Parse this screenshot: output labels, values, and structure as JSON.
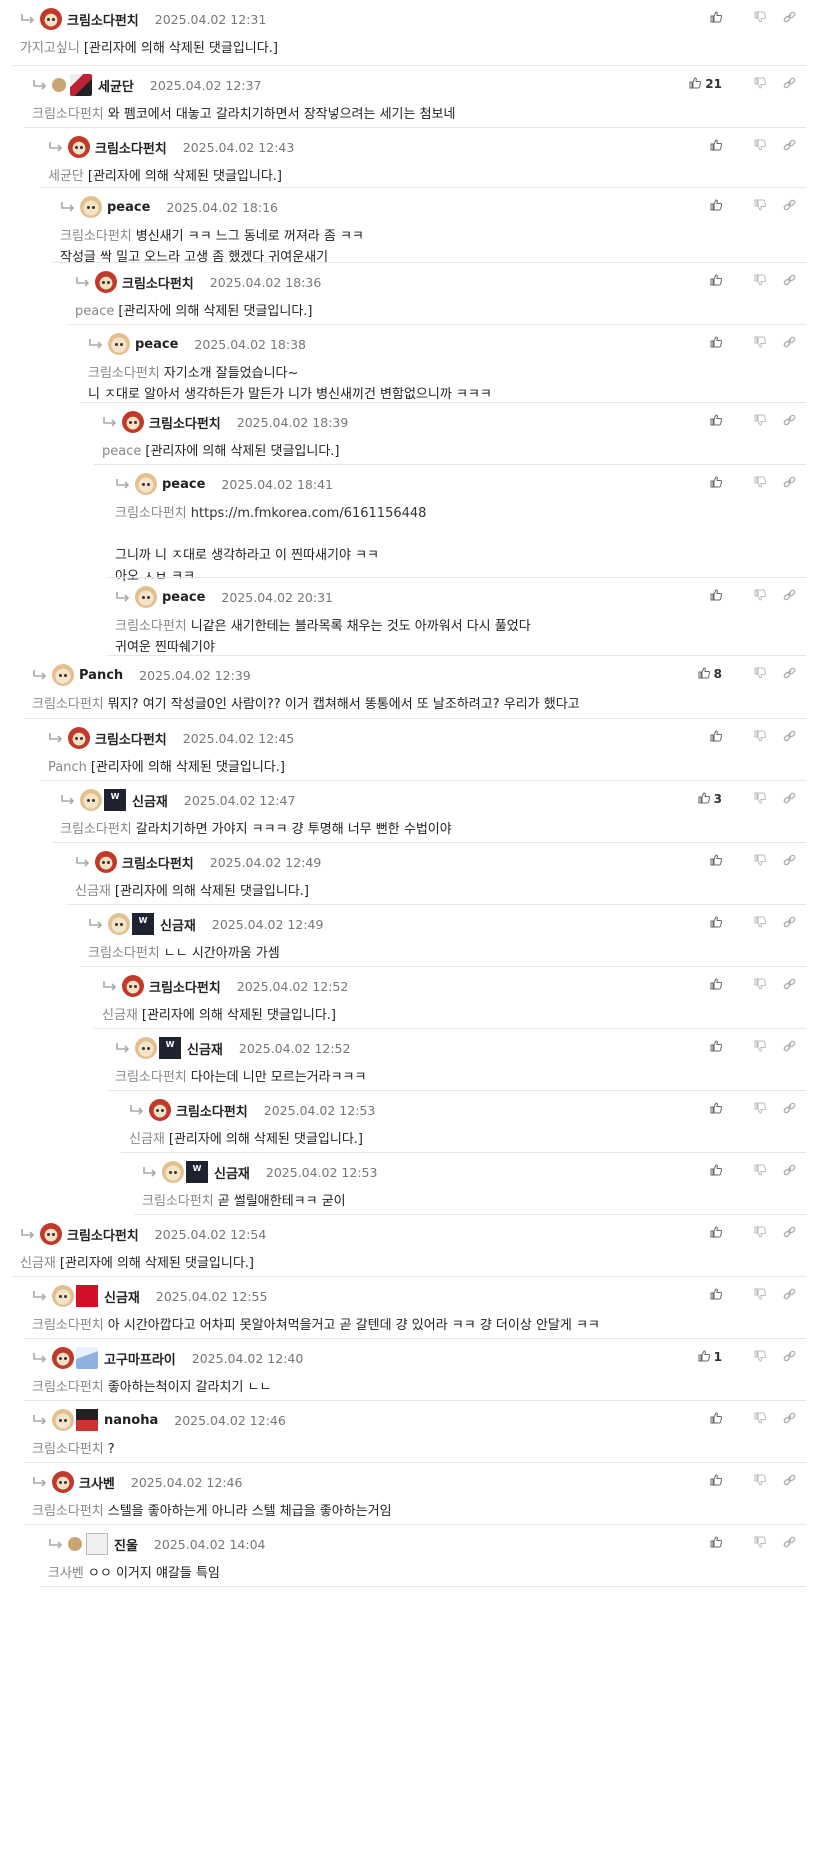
{
  "comments": [
    {
      "nick": "크림소다펀치",
      "date": "2025.04.02 12:31",
      "avatar": "pet-red",
      "badge": "",
      "dot": false,
      "upcount": "",
      "mention": "가지고싶니",
      "lines": [
        "[관리자에 의해 삭제된 댓글입니다.]"
      ]
    },
    {
      "nick": "세균단",
      "date": "2025.04.02 12:37",
      "avatar": "dot",
      "badge": "avatar2",
      "dot": true,
      "upcount": "21",
      "mention": "크림소다펀치",
      "lines": [
        "와 펨코에서 대놓고 갈라치기하면서 장작넣으려는 세기는 첨보네"
      ]
    },
    {
      "nick": "크림소다펀치",
      "date": "2025.04.02 12:43",
      "avatar": "pet-red",
      "badge": "",
      "dot": false,
      "upcount": "",
      "mention": "세균단",
      "lines": [
        "[관리자에 의해 삭제된 댓글입니다.]"
      ]
    },
    {
      "nick": "peace",
      "date": "2025.04.02 18:16",
      "avatar": "pet-plain",
      "badge": "",
      "dot": false,
      "upcount": "",
      "mention": "크림소다펀치",
      "lines": [
        "병신새기 ㅋㅋ 느그 동네로 꺼져라 좀 ㅋㅋ",
        "작성글 싹 밀고 오느라 고생 좀 했겠다 귀여운새기"
      ]
    },
    {
      "nick": "크림소다펀치",
      "date": "2025.04.02 18:36",
      "avatar": "pet-red",
      "badge": "",
      "dot": false,
      "upcount": "",
      "mention": "peace",
      "lines": [
        "[관리자에 의해 삭제된 댓글입니다.]"
      ]
    },
    {
      "nick": "peace",
      "date": "2025.04.02 18:38",
      "avatar": "pet-plain",
      "badge": "",
      "dot": false,
      "upcount": "",
      "mention": "크림소다펀치",
      "lines": [
        "자기소개 잘들었습니다~",
        "니 ㅈ대로 알아서 생각하든가 말든가 니가 병신새끼건 변함없으니까 ㅋㅋㅋ"
      ]
    },
    {
      "nick": "크림소다펀치",
      "date": "2025.04.02 18:39",
      "avatar": "pet-red",
      "badge": "",
      "dot": false,
      "upcount": "",
      "mention": "peace",
      "lines": [
        "[관리자에 의해 삭제된 댓글입니다.]"
      ]
    },
    {
      "nick": "peace",
      "date": "2025.04.02 18:41",
      "avatar": "pet-plain",
      "badge": "",
      "dot": false,
      "upcount": "",
      "mention": "크림소다펀치",
      "lines": [
        "https://m.fmkorea.com/6161156448",
        "",
        "그니까 니 ㅈ대로 생각하라고 이 찐따새기야 ㅋㅋ",
        "아오 ㅅㅂ ㅋㅋ"
      ]
    },
    {
      "nick": "peace",
      "date": "2025.04.02 20:31",
      "avatar": "pet-plain",
      "badge": "",
      "dot": false,
      "upcount": "",
      "mention": "크림소다펀치",
      "lines": [
        "니같은 새기한테는 블라목록 채우는 것도 아까워서 다시 풀었다",
        "귀여운 찐따쉐기야"
      ]
    },
    {
      "nick": "Panch",
      "date": "2025.04.02 12:39",
      "avatar": "pet-plain",
      "badge": "",
      "dot": false,
      "upcount": "8",
      "mention": "크림소다펀치",
      "lines": [
        "뭐지? 여기 작성글0인 사람이?? 이거 캡쳐해서 똥통에서 또 날조하려고? 우리가 했다고"
      ]
    },
    {
      "nick": "크림소다펀치",
      "date": "2025.04.02 12:45",
      "avatar": "pet-red",
      "badge": "",
      "dot": false,
      "upcount": "",
      "mention": "Panch",
      "lines": [
        "[관리자에 의해 삭제된 댓글입니다.]"
      ]
    },
    {
      "nick": "신금재",
      "date": "2025.04.02 12:47",
      "avatar": "pet-plain",
      "badge": "worlds",
      "dot": false,
      "upcount": "3",
      "mention": "크림소다펀치",
      "lines": [
        "갈라치기하면 가야지 ㅋㅋㅋ 걍 투명해 너무 뻔한 수법이야"
      ]
    },
    {
      "nick": "크림소다펀치",
      "date": "2025.04.02 12:49",
      "avatar": "pet-red",
      "badge": "",
      "dot": false,
      "upcount": "",
      "mention": "신금재",
      "lines": [
        "[관리자에 의해 삭제된 댓글입니다.]"
      ]
    },
    {
      "nick": "신금재",
      "date": "2025.04.02 12:49",
      "avatar": "pet-plain",
      "badge": "worlds",
      "dot": false,
      "upcount": "",
      "mention": "크림소다펀치",
      "lines": [
        "ㄴㄴ 시간아까움 가셈"
      ]
    },
    {
      "nick": "크림소다펀치",
      "date": "2025.04.02 12:52",
      "avatar": "pet-red",
      "badge": "",
      "dot": false,
      "upcount": "",
      "mention": "신금재",
      "lines": [
        "[관리자에 의해 삭제된 댓글입니다.]"
      ]
    },
    {
      "nick": "신금재",
      "date": "2025.04.02 12:52",
      "avatar": "pet-plain",
      "badge": "worlds",
      "dot": false,
      "upcount": "",
      "mention": "크림소다펀치",
      "lines": [
        "다아는데 니만 모르는거라ㅋㅋㅋ"
      ]
    },
    {
      "nick": "크림소다펀치",
      "date": "2025.04.02 12:53",
      "avatar": "pet-red",
      "badge": "",
      "dot": false,
      "upcount": "",
      "mention": "신금재",
      "lines": [
        "[관리자에 의해 삭제된 댓글입니다.]"
      ]
    },
    {
      "nick": "신금재",
      "date": "2025.04.02 12:53",
      "avatar": "pet-plain",
      "badge": "worlds",
      "dot": false,
      "upcount": "",
      "mention": "크림소다펀치",
      "lines": [
        "곧 썰릴애한테ㅋㅋ 굳이"
      ]
    },
    {
      "nick": "크림소다펀치",
      "date": "2025.04.02 12:54",
      "avatar": "pet-red",
      "badge": "",
      "dot": false,
      "upcount": "",
      "mention": "신금재",
      "lines": [
        "[관리자에 의해 삭제된 댓글입니다.]"
      ]
    },
    {
      "nick": "신금재",
      "date": "2025.04.02 12:55",
      "avatar": "pet-plain",
      "badge": "t1",
      "dot": false,
      "upcount": "",
      "mention": "크림소다펀치",
      "lines": [
        "아 시간아깝다고 어차피 못알아쳐먹을거고 곧 갈텐데 걍 있어라 ㅋㅋ 걍 더이상 안달게 ㅋㅋ"
      ]
    },
    {
      "nick": "고구마프라이",
      "date": "2025.04.02 12:40",
      "avatar": "pet-red",
      "badge": "anime",
      "dot": false,
      "upcount": "1",
      "mention": "크림소다펀치",
      "lines": [
        "좋아하는척이지 갈라치기 ㄴㄴ"
      ]
    },
    {
      "nick": "nanoha",
      "date": "2025.04.02 12:46",
      "avatar": "pet-plain",
      "badge": "nanoha",
      "dot": false,
      "upcount": "",
      "mention": "크림소다펀치",
      "lines": [
        "?"
      ]
    },
    {
      "nick": "크사벤",
      "date": "2025.04.02 12:46",
      "avatar": "pet-red",
      "badge": "",
      "dot": false,
      "upcount": "",
      "mention": "크림소다펀치",
      "lines": [
        "스텔을 좋아하는게 아니라 스텔 체급을 좋아하는거임"
      ]
    },
    {
      "nick": "진울",
      "date": "2025.04.02 14:04",
      "avatar": "dot",
      "badge": "jinul",
      "dot": true,
      "upcount": "",
      "mention": "크사벤",
      "lines": [
        "ㅇㅇ 이거지 얘갈들 특임"
      ]
    }
  ],
  "icons": {
    "upvote": "thumbs-up-icon",
    "downvote": "thumbs-down-icon",
    "link": "link-icon",
    "reply_arrow": "reply-arrow-icon"
  }
}
